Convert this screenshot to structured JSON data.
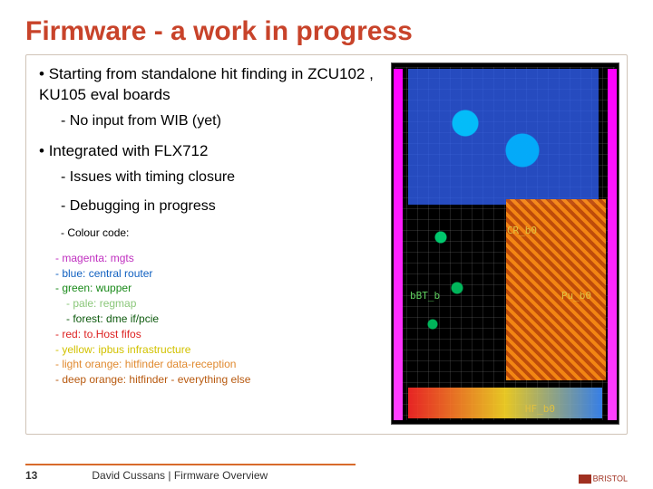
{
  "title": "Firmware - a work in progress",
  "bullets": {
    "b1": "Starting from standalone hit finding in ZCU102 , KU105 eval boards",
    "b1a": "No input from WIB (yet)",
    "b2": "Integrated with FLX712",
    "b2a": "Issues with timing closure",
    "b2b": "Debugging in progress",
    "b2c": "Colour code:"
  },
  "colour_code": {
    "magenta": "magenta: mgts",
    "blue": "blue: central router",
    "green": "green: wupper",
    "pale": "pale: regmap",
    "forest": "forest: dme if/pcie",
    "red": "red: to.Host fifos",
    "yellow": "yellow: ipbus infrastructure",
    "lorange": "light orange: hitfinder data-reception",
    "dorange": "deep orange: hitfinder - everything else"
  },
  "fpga_tags": {
    "cr": "CR_b0",
    "bt": "bBT_b",
    "pu": "Pu_b0",
    "hf": "HF_b0"
  },
  "footer": {
    "page": "13",
    "text": "David Cussans | Firmware Overview",
    "logo": "BRISTOL"
  }
}
